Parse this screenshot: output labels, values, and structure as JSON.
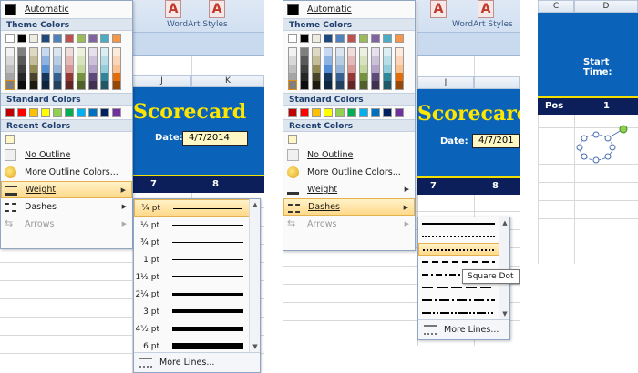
{
  "colors": {
    "theme_top": [
      "#ffffff",
      "#000000",
      "#eeece1",
      "#1f497d",
      "#4f81bd",
      "#c0504d",
      "#9bbb59",
      "#8064a2",
      "#4bacc6",
      "#f79646"
    ],
    "theme_shades": [
      [
        "#f2f2f2",
        "#d8d8d8",
        "#bfbfbf",
        "#a5a5a5",
        "#7f7f7f"
      ],
      [
        "#7f7f7f",
        "#595959",
        "#3f3f3f",
        "#262626",
        "#0c0c0c"
      ],
      [
        "#ddd9c3",
        "#c4bd97",
        "#938953",
        "#494429",
        "#1d1b10"
      ],
      [
        "#c6d9f0",
        "#8db3e2",
        "#548dd4",
        "#17365d",
        "#0f243e"
      ],
      [
        "#dbe5f1",
        "#b8cce4",
        "#95b3d7",
        "#366092",
        "#244061"
      ],
      [
        "#f2dcdb",
        "#e5b9b7",
        "#d99694",
        "#953734",
        "#632423"
      ],
      [
        "#ebf1dd",
        "#d7e3bc",
        "#c3d69b",
        "#76923c",
        "#4f6128"
      ],
      [
        "#e5e0ec",
        "#ccc1d9",
        "#b2a2c7",
        "#5f497a",
        "#3f3151"
      ],
      [
        "#dbeef3",
        "#b7dde8",
        "#92cddc",
        "#31859b",
        "#205867"
      ],
      [
        "#fdeada",
        "#fbd5b5",
        "#fac08f",
        "#e36c09",
        "#974806"
      ]
    ],
    "standard": [
      "#c00000",
      "#ff0000",
      "#ffc000",
      "#ffff00",
      "#92d050",
      "#00b050",
      "#00b0f0",
      "#0070c0",
      "#002060",
      "#7030a0"
    ],
    "recent": [
      "#fff8c4"
    ]
  },
  "left": {
    "ribbon_group": "WordArt Styles",
    "ribbon_chip": "A",
    "columns": [
      "J",
      "K"
    ],
    "title": "Scorecard",
    "date_label": "Date:",
    "date_value": "4/7/2014",
    "band_values": [
      "7",
      "8"
    ],
    "menu": {
      "automatic": "Automatic",
      "theme_colors": "Theme Colors",
      "standard_colors": "Standard Colors",
      "recent_colors": "Recent Colors",
      "no_outline": "No Outline",
      "more_colors": "More Outline Colors...",
      "weight": "Weight",
      "dashes": "Dashes",
      "arrows": "Arrows"
    },
    "weights": [
      "¼ pt",
      "½ pt",
      "¾ pt",
      "1 pt",
      "1½ pt",
      "2¼ pt",
      "3 pt",
      "4½ pt",
      "6 pt"
    ],
    "more_lines": "More Lines..."
  },
  "middle": {
    "ribbon_group": "WordArt Styles",
    "ribbon_chip": "A",
    "columns": [
      "J"
    ],
    "title": "Scorecard",
    "date_label": "Date:",
    "date_value": "4/7/201",
    "band_values": [
      "7",
      "8"
    ],
    "menu": {
      "automatic": "Automatic",
      "theme_colors": "Theme Colors",
      "standard_colors": "Standard Colors",
      "recent_colors": "Recent Colors",
      "no_outline": "No Outline",
      "more_colors": "More Outline Colors...",
      "weight": "Weight",
      "dashes": "Dashes",
      "arrows": "Arrows"
    },
    "tooltip": "Square Dot",
    "more_lines": "More Lines..."
  },
  "right": {
    "columns": [
      "C",
      "D"
    ],
    "start_time_label": "Start Time:",
    "pos_label": "Pos",
    "pos_value": "1"
  }
}
